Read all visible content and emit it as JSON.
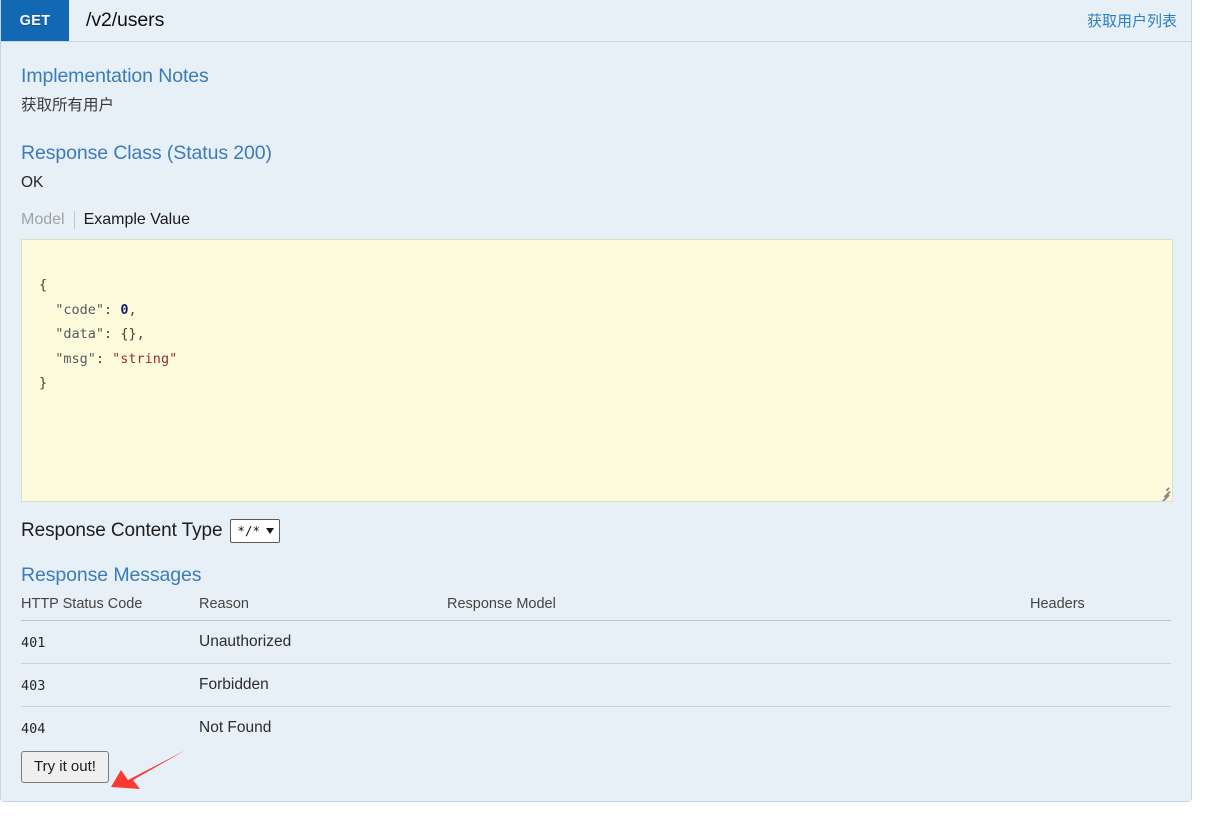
{
  "operation": {
    "method": "GET",
    "path": "/v2/users",
    "summary": "获取用户列表"
  },
  "implementation_notes": {
    "title": "Implementation Notes",
    "body": "获取所有用户"
  },
  "response_class": {
    "title": "Response Class (Status 200)",
    "status_text": "OK",
    "tabs": [
      {
        "label": "Model",
        "active": false
      },
      {
        "label": "Example Value",
        "active": true
      }
    ],
    "example_value": {
      "line_open": "{",
      "fields": [
        {
          "key": "\"code\"",
          "sep": ": ",
          "value": "0",
          "value_type": "num",
          "comma": ","
        },
        {
          "key": "\"data\"",
          "sep": ": ",
          "value": "{}",
          "value_type": "p",
          "comma": ","
        },
        {
          "key": "\"msg\"",
          "sep": ": ",
          "value": "\"string\"",
          "value_type": "str",
          "comma": ""
        }
      ],
      "line_close": "}"
    }
  },
  "content_type": {
    "label": "Response Content Type",
    "selected": "*/*",
    "options": [
      "*/*"
    ]
  },
  "response_messages": {
    "title": "Response Messages",
    "columns": [
      "HTTP Status Code",
      "Reason",
      "Response Model",
      "Headers"
    ],
    "rows": [
      {
        "status": "401",
        "reason": "Unauthorized",
        "model": "",
        "headers": ""
      },
      {
        "status": "403",
        "reason": "Forbidden",
        "model": "",
        "headers": ""
      },
      {
        "status": "404",
        "reason": "Not Found",
        "model": "",
        "headers": ""
      }
    ]
  },
  "actions": {
    "try_it_out": "Try it out!"
  },
  "colors": {
    "method_badge": "#1268b3",
    "heading_text": "#3b7cb8",
    "summary_link": "#2a7fc1",
    "panel_background": "#e7f0f7",
    "code_background": "#fcfcdd",
    "annotation_arrow": "#f93a33"
  }
}
